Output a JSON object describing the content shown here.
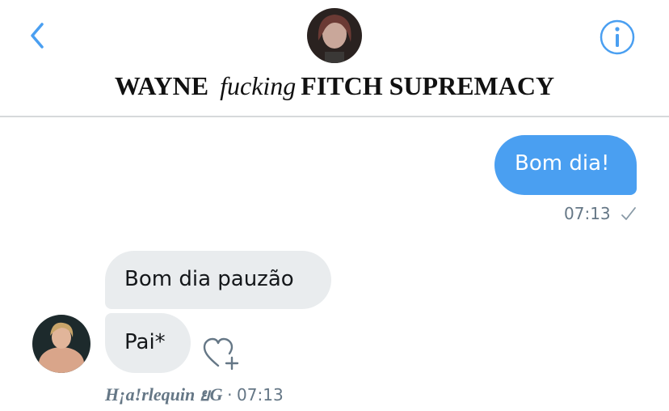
{
  "header": {
    "title_part1": "WAYNE",
    "title_part2": "fucking",
    "title_part3": "FITCH SUPREMACY",
    "back_icon": "chevron-left-icon",
    "info_icon": "info-icon",
    "accent_color": "#4a9ff1"
  },
  "messages": [
    {
      "direction": "outgoing",
      "text": "Bom dia!",
      "time": "07:13",
      "status_icon": "checkmark-icon"
    },
    {
      "direction": "incoming",
      "text": "Bom dia pauzão"
    },
    {
      "direction": "incoming",
      "text": "Pai*",
      "reaction_icon": "heart-plus-icon"
    }
  ],
  "incoming_meta": {
    "sender": "H¡a!rlequin ยG",
    "separator": "·",
    "time": "07:13"
  },
  "colors": {
    "outgoing_bubble": "#4a9ff1",
    "incoming_bubble": "#e9ecee",
    "meta_text": "#657786"
  }
}
